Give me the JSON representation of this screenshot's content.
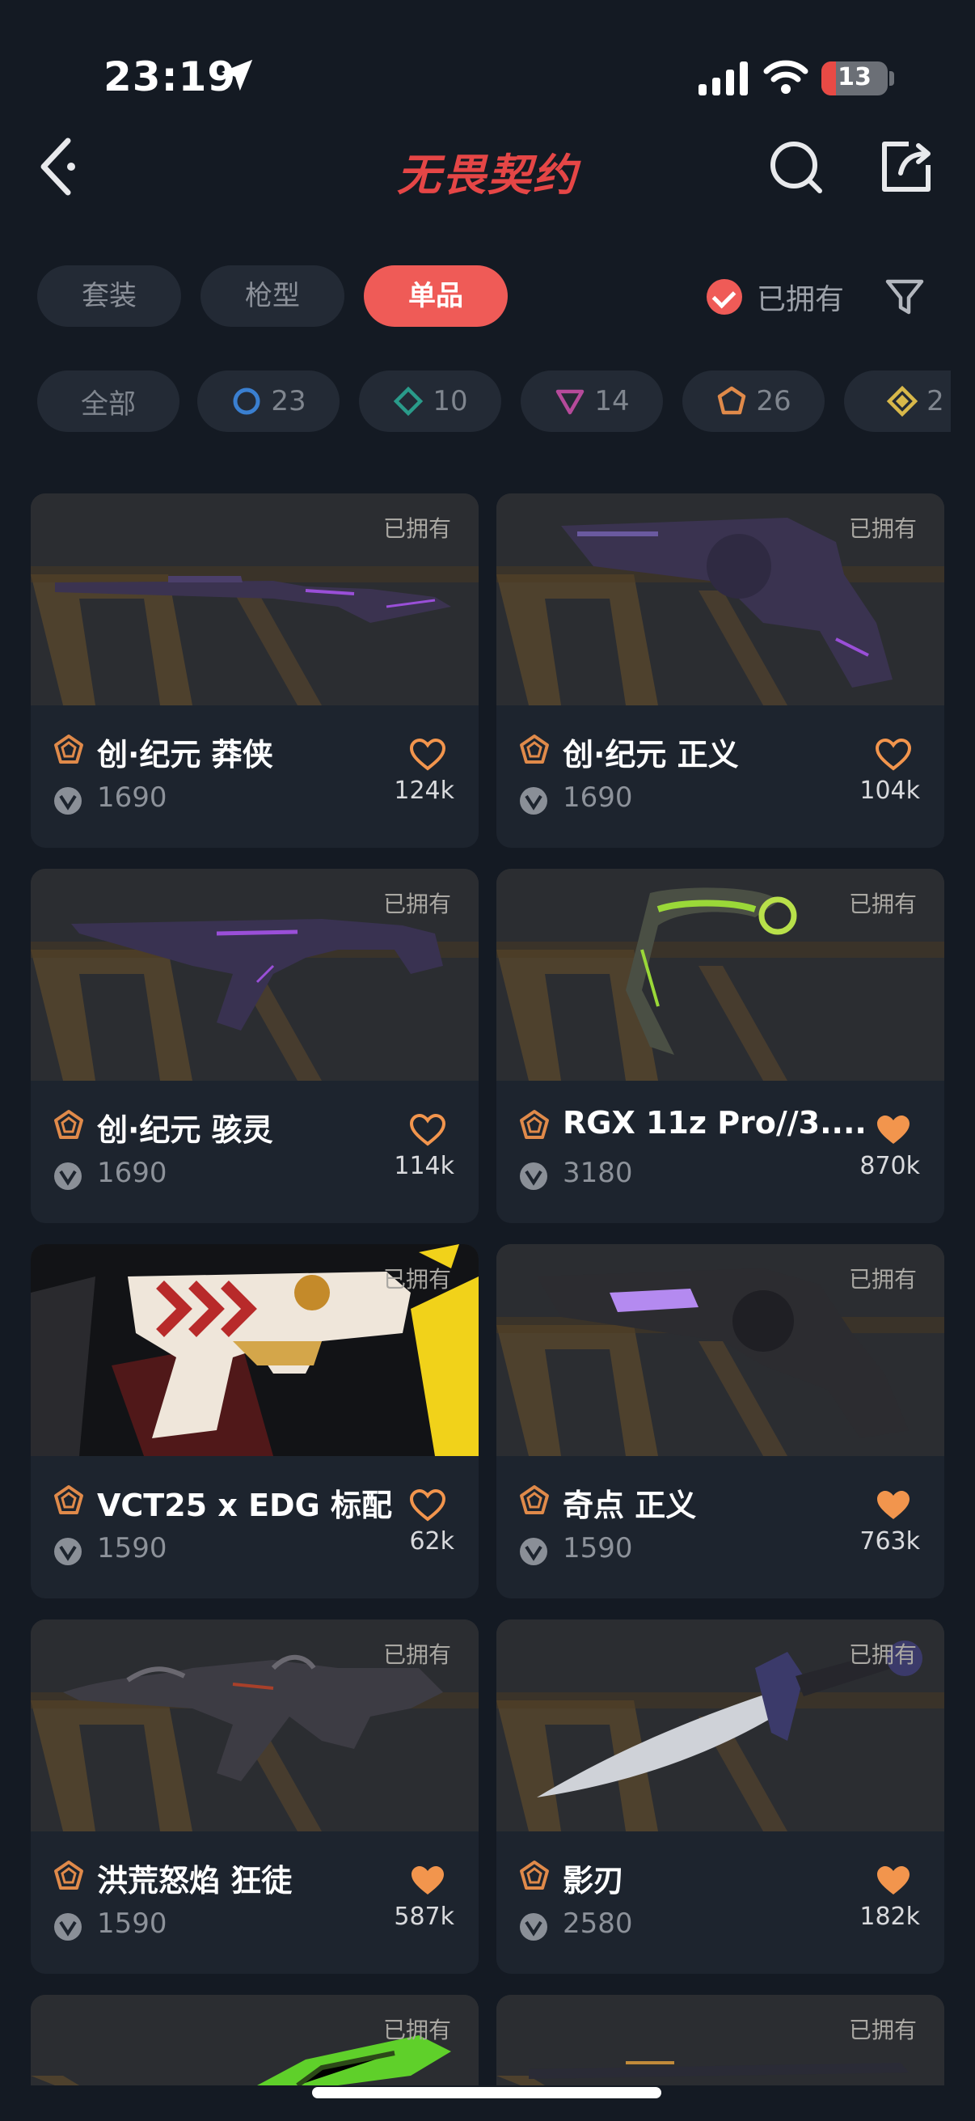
{
  "status_bar": {
    "time": "23:19",
    "battery": "13"
  },
  "nav": {
    "title": "无畏契约"
  },
  "tabs": [
    {
      "label": "套装",
      "active": false
    },
    {
      "label": "枪型",
      "active": false
    },
    {
      "label": "单品",
      "active": true
    }
  ],
  "owned_filter": {
    "label": "已拥有",
    "checked": true
  },
  "tier_chips": [
    {
      "label": "全部",
      "icon": "none"
    },
    {
      "label": "23",
      "icon": "select-tier-icon",
      "color": "#3a7fd0"
    },
    {
      "label": "10",
      "icon": "deluxe-tier-icon",
      "color": "#2a9b8a"
    },
    {
      "label": "14",
      "icon": "premium-tier-icon",
      "color": "#b54a9a"
    },
    {
      "label": "26",
      "icon": "exclusive-tier-icon",
      "color": "#e08a4a"
    },
    {
      "label": "2",
      "icon": "ultra-tier-icon",
      "color": "#d8b84a"
    }
  ],
  "items": [
    {
      "owned_label": "已拥有",
      "name": "创·纪元 莽侠",
      "price": "1690",
      "likes": "124k",
      "favorited": false
    },
    {
      "owned_label": "已拥有",
      "name": "创·纪元 正义",
      "price": "1690",
      "likes": "104k",
      "favorited": false
    },
    {
      "owned_label": "已拥有",
      "name": "创·纪元 骇灵",
      "price": "1690",
      "likes": "114k",
      "favorited": false
    },
    {
      "owned_label": "已拥有",
      "name": "RGX 11z Pro//3....",
      "price": "3180",
      "likes": "870k",
      "favorited": true
    },
    {
      "owned_label": "已拥有",
      "name": "VCT25 x EDG 标配",
      "price": "1590",
      "likes": "62k",
      "favorited": false
    },
    {
      "owned_label": "已拥有",
      "name": "奇点 正义",
      "price": "1590",
      "likes": "763k",
      "favorited": true
    },
    {
      "owned_label": "已拥有",
      "name": "洪荒怒焰 狂徒",
      "price": "1590",
      "likes": "587k",
      "favorited": true
    },
    {
      "owned_label": "已拥有",
      "name": "影刃",
      "price": "2580",
      "likes": "182k",
      "favorited": true
    },
    {
      "owned_label": "已拥有"
    },
    {
      "owned_label": "已拥有"
    }
  ],
  "colors": {
    "accent": "#ef5b57",
    "tier_exclusive": "#e08a4a",
    "fav_filled": "#f2954d"
  }
}
